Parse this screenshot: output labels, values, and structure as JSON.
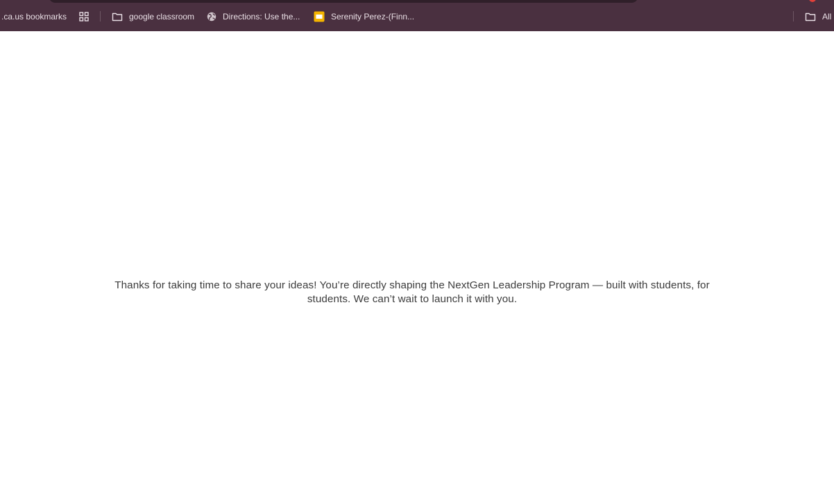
{
  "bookmarks_bar": {
    "items": [
      {
        "label": ".ca.us bookmarks",
        "icon": "none"
      },
      {
        "label": "google classroom",
        "icon": "folder-icon"
      },
      {
        "label": "Directions:  Use the...",
        "icon": "globe-icon"
      },
      {
        "label": "Serenity Perez-(Finn...",
        "icon": "slides-icon"
      }
    ],
    "all_bookmarks_label": "All",
    "colors": {
      "background": "#4a3040",
      "text": "#e9dfe5",
      "slides_icon": "#f4b400"
    }
  },
  "page": {
    "message": "Thanks for taking  time to share your ideas! You’re directly shaping the NextGen Leadership Program — built with students, for students. We can’t wait to launch it with you."
  }
}
